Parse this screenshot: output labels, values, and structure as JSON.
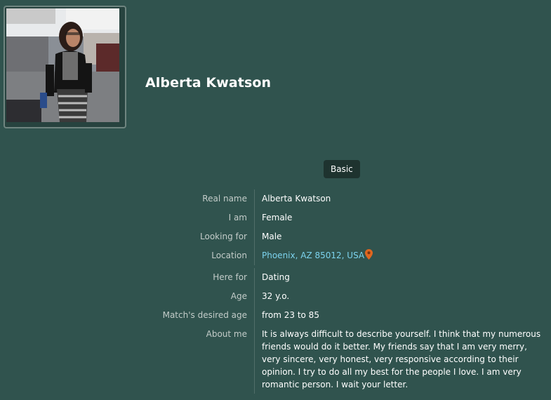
{
  "profile": {
    "name": "Alberta Kwatson"
  },
  "tabs": {
    "basic_label": "Basic"
  },
  "details": {
    "real_name": {
      "label": "Real name",
      "value": "Alberta Kwatson"
    },
    "i_am": {
      "label": "I am",
      "value": "Female"
    },
    "looking_for": {
      "label": "Looking for",
      "value": "Male"
    },
    "location": {
      "label": "Location",
      "value": "Phoenix, AZ 85012, USA"
    },
    "here_for": {
      "label": "Here for",
      "value": "Dating"
    },
    "age": {
      "label": "Age",
      "value": "32 y.o."
    },
    "desired_age": {
      "label": "Match's desired age",
      "value": "from 23 to 85"
    },
    "about": {
      "label": "About me",
      "value": "It is always difficult to describe yourself. I think that my numerous friends would do it better. My friends say that I am very merry, very sincere, very honest, very responsive according to their opinion. I try to do all my best for the people I love. I am very romantic person. I wait your letter."
    }
  },
  "colors": {
    "background": "#30534e",
    "link": "#7cd3ee",
    "pin": "#e0661f"
  },
  "icons": {
    "location": "map-pin-icon"
  }
}
